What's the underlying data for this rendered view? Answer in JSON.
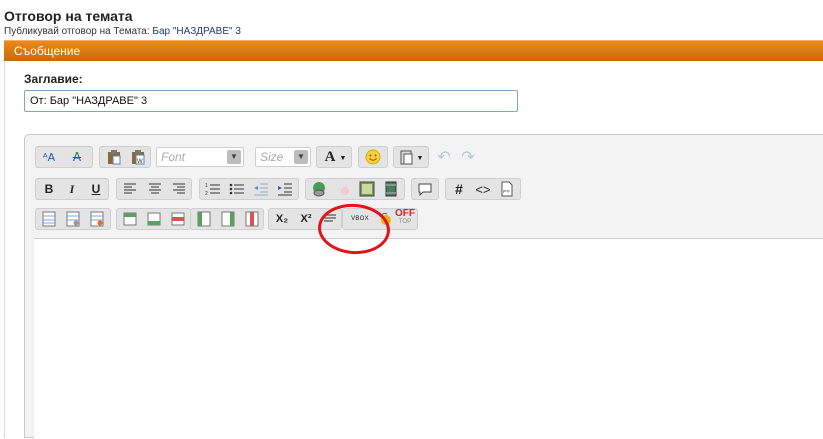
{
  "page": {
    "title": "Отговор на темата",
    "subtitle_prefix": "Публикувай отговор на Темата:",
    "topic_link": "Бар \"НАЗДРАВЕ\" 3"
  },
  "panel": {
    "header": "Съобщение"
  },
  "subject": {
    "label": "Заглавие:",
    "value": "От: Бар \"НАЗДРАВЕ\" 3"
  },
  "toolbar": {
    "font_placeholder": "Font",
    "size_placeholder": "Size",
    "bold": "B",
    "italic": "I",
    "underline": "U",
    "hash": "#",
    "code": "<>",
    "font_color": "A",
    "subscript": "X₂",
    "superscript": "X²",
    "vbox": "VBOX",
    "off_top": "OFF",
    "off_bottom": "TOP"
  },
  "colors": {
    "header": "#d9770f",
    "highlight": "#e0141a",
    "input_border": "#7aa5c6"
  }
}
